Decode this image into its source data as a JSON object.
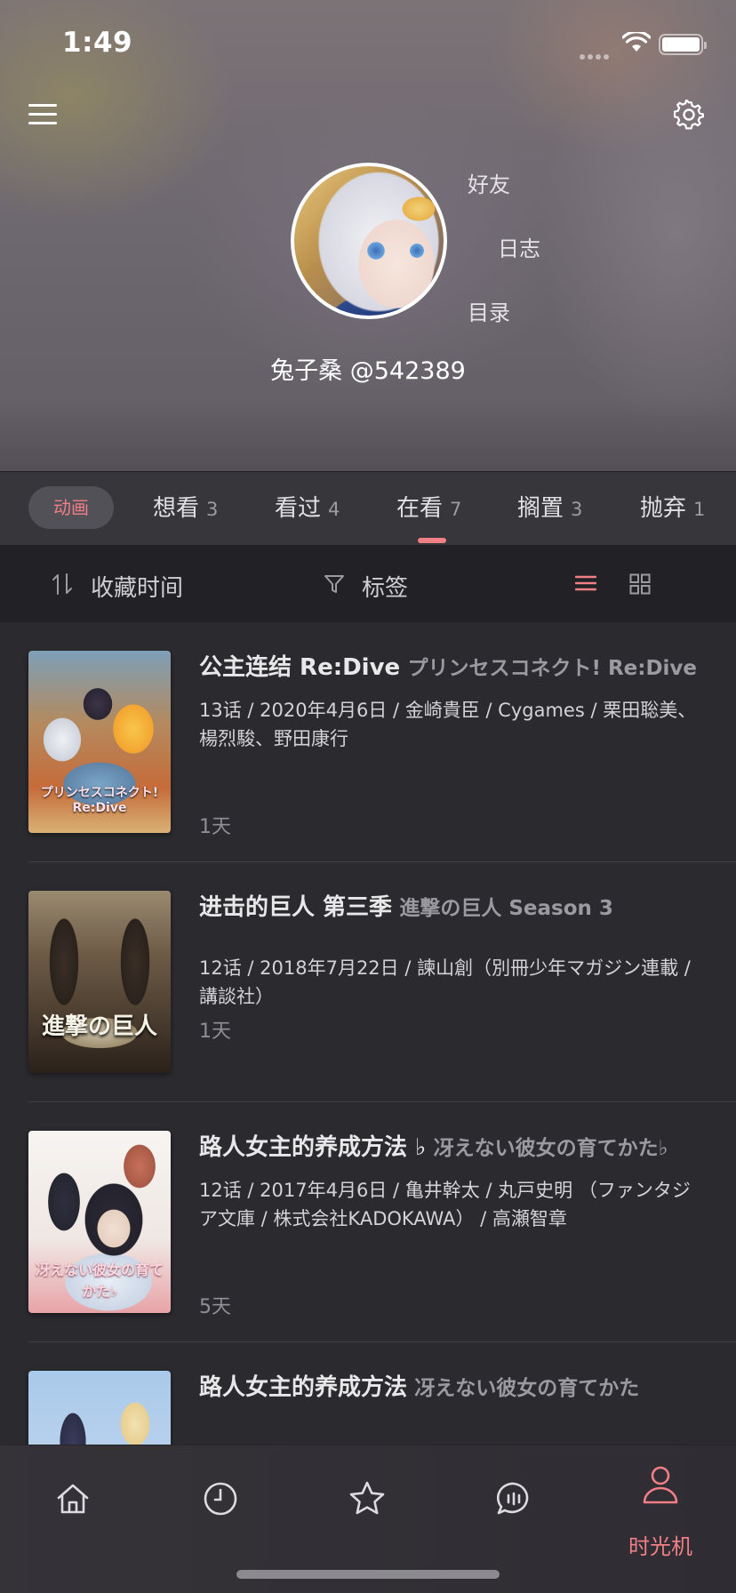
{
  "status_bar": {
    "time": "1:49"
  },
  "profile": {
    "links": {
      "friends": "好友",
      "blog": "日志",
      "index": "目录"
    },
    "username": "兔子桑 @542389"
  },
  "tabs": {
    "chip": "动画",
    "items": [
      {
        "label": "想看",
        "count": "3"
      },
      {
        "label": "看过",
        "count": "4"
      },
      {
        "label": "在看",
        "count": "7"
      },
      {
        "label": "搁置",
        "count": "3"
      },
      {
        "label": "抛弃",
        "count": "1"
      }
    ],
    "active_index": 2
  },
  "filters": {
    "sort": "收藏时间",
    "tags": "标签"
  },
  "colors": {
    "accent": "#f07f86",
    "background": "#2b2b2f",
    "tab_bar": "#36363b",
    "filter_bar": "#222226"
  },
  "items": [
    {
      "title_cn": "公主连结 Re:Dive",
      "title_jp": "プリンセスコネクト! Re:Dive",
      "info": "13话 / 2020年4月6日 / 金崎貴臣 / Cygames / 栗田聡美、楊烈駿、野田康行",
      "time": "1天",
      "cover_text": "プリンセスコネクト! Re:Dive"
    },
    {
      "title_cn": "进击的巨人 第三季",
      "title_jp": "進撃の巨人 Season 3",
      "info": "12话 / 2018年7月22日 / 諫山創（別冊少年マガジン連載 / 講談社）",
      "time": "1天",
      "cover_text": "進撃の巨人"
    },
    {
      "title_cn": "路人女主的养成方法 ♭",
      "title_jp": "冴えない彼女の育てかた♭",
      "info": "12话 / 2017年4月6日 / 亀井幹太 / 丸戸史明 （ファンタジア文庫 / 株式会社KADOKAWA） / 高瀬智章",
      "time": "5天",
      "cover_text": "冴えない彼女の育てかた♭"
    },
    {
      "title_cn": "路人女主的养成方法",
      "title_jp": "冴えない彼女の育てかた",
      "info": "",
      "time": "",
      "cover_text": ""
    }
  ],
  "bottom_nav": {
    "icons": [
      "home-icon",
      "clock-icon",
      "star-icon",
      "chat-icon",
      "person-icon"
    ],
    "active_label": "时光机"
  }
}
